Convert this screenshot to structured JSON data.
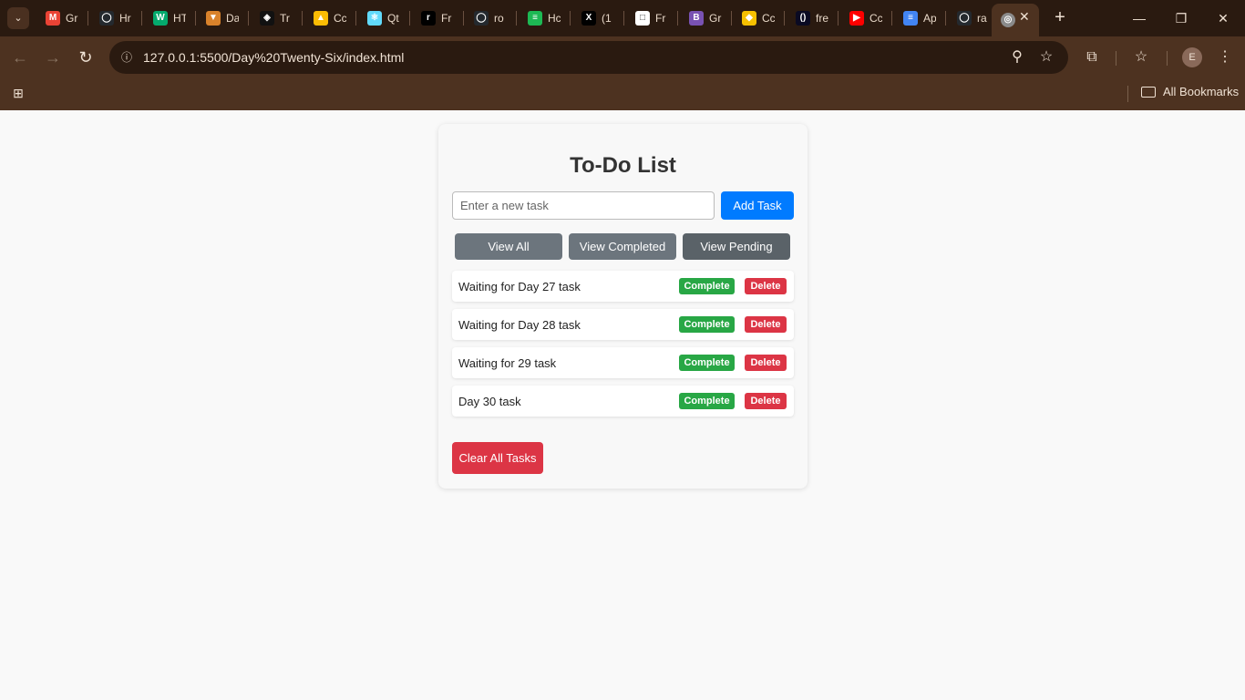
{
  "browser": {
    "tabs": [
      {
        "label": "Gr",
        "icon": "gmail-icon",
        "color": "#ea4335",
        "glyph": "M"
      },
      {
        "label": "Hr",
        "icon": "github-icon",
        "color": "#24292e",
        "glyph": "◯"
      },
      {
        "label": "HT",
        "icon": "w3schools-icon",
        "color": "#04aa6d",
        "glyph": "W"
      },
      {
        "label": "Da",
        "icon": "fox-icon",
        "color": "#d9822b",
        "glyph": "▼"
      },
      {
        "label": "Tr",
        "icon": "codepen-icon",
        "color": "#111111",
        "glyph": "◈"
      },
      {
        "label": "Cc",
        "icon": "google-drive-icon",
        "color": "#fbbc04",
        "glyph": "▲"
      },
      {
        "label": "Qt",
        "icon": "react-icon",
        "color": "#61dafb",
        "glyph": "⚛"
      },
      {
        "label": "Fr",
        "icon": "framer-icon",
        "color": "#000000",
        "glyph": "r"
      },
      {
        "label": "ro",
        "icon": "github-icon",
        "color": "#24292e",
        "glyph": "◯"
      },
      {
        "label": "Hc",
        "icon": "spotify-icon",
        "color": "#1db954",
        "glyph": "≡"
      },
      {
        "label": "(1",
        "icon": "x-icon",
        "color": "#000000",
        "glyph": "X"
      },
      {
        "label": "Fr",
        "icon": "document-icon",
        "color": "#ffffff",
        "glyph": "□"
      },
      {
        "label": "Gr",
        "icon": "bootstrap-icon",
        "color": "#7952b3",
        "glyph": "B"
      },
      {
        "label": "Cc",
        "icon": "coursera-icon",
        "color": "#f6c000",
        "glyph": "◆"
      },
      {
        "label": "fre",
        "icon": "freecodecamp-icon",
        "color": "#0a0a23",
        "glyph": "()"
      },
      {
        "label": "Cc",
        "icon": "youtube-icon",
        "color": "#ff0000",
        "glyph": "▶"
      },
      {
        "label": "Ap",
        "icon": "google-docs-icon",
        "color": "#4285f4",
        "glyph": "≡"
      },
      {
        "label": "ra",
        "icon": "github-icon",
        "color": "#24292e",
        "glyph": "◯"
      }
    ],
    "url": "127.0.0.1:5500/Day%20Twenty-Six/index.html",
    "profile_initial": "E",
    "bookmarks_label": "All Bookmarks"
  },
  "app": {
    "title": "To-Do List",
    "input_placeholder": "Enter a new task",
    "add_button": "Add Task",
    "filters": {
      "all": "View All",
      "completed": "View Completed",
      "pending": "View Pending"
    },
    "tasks": [
      {
        "text": "Waiting for Day 27 task",
        "complete_label": "Complete",
        "delete_label": "Delete"
      },
      {
        "text": "Waiting for Day 28 task",
        "complete_label": "Complete",
        "delete_label": "Delete"
      },
      {
        "text": "Waiting for 29 task",
        "complete_label": "Complete",
        "delete_label": "Delete"
      },
      {
        "text": "Day 30 task",
        "complete_label": "Complete",
        "delete_label": "Delete"
      }
    ],
    "clear_button": "Clear All Tasks"
  },
  "colors": {
    "primary": "#007bff",
    "filter": "#6c757d",
    "complete": "#28a745",
    "danger": "#dc3545",
    "chrome_dark": "#2a1a10",
    "chrome": "#4d3220"
  }
}
